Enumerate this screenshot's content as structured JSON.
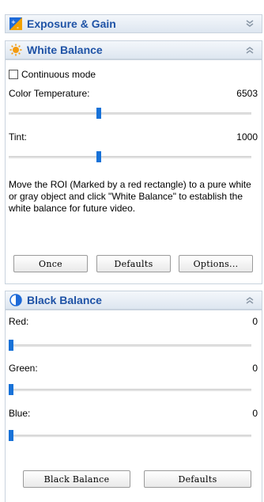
{
  "exposure": {
    "title": "Exposure & Gain"
  },
  "white_balance": {
    "title": "White Balance",
    "continuous_label": "Continuous mode",
    "continuous_checked": false,
    "color_temp_label": "Color Temperature:",
    "color_temp_value": "6503",
    "color_temp_fraction": 0.37,
    "tint_label": "Tint:",
    "tint_value": "1000",
    "tint_fraction": 0.37,
    "description": "Move the ROI (Marked by a red rectangle) to a pure white or gray object and click \"White Balance\" to establish the white balance for future video.",
    "buttons": {
      "once": "Once",
      "defaults": "Defaults",
      "options": "Options..."
    }
  },
  "black_balance": {
    "title": "Black Balance",
    "red_label": "Red:",
    "red_value": "0",
    "red_fraction": 0.0,
    "green_label": "Green:",
    "green_value": "0",
    "green_fraction": 0.0,
    "blue_label": "Blue:",
    "blue_value": "0",
    "blue_fraction": 0.0,
    "buttons": {
      "black_balance": "Black Balance",
      "defaults": "Defaults"
    }
  },
  "colors": {
    "header_text": "#1f53a6",
    "slider_thumb": "#1872d8",
    "panel_border": "#c9d3de"
  }
}
